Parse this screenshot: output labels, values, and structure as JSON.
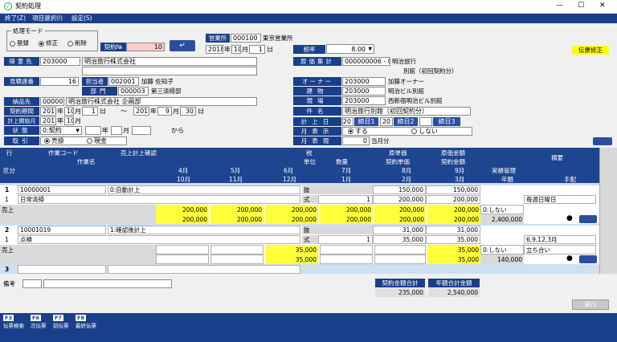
{
  "titlebar": {
    "title": "契約処理",
    "min": "—",
    "max": "☐",
    "close": "✕"
  },
  "menu": [
    "終了(Z)",
    "項目選択(I)",
    "設定(S)"
  ],
  "mode": {
    "legend": "処理モード",
    "options": [
      "登録",
      "修正",
      "削除"
    ],
    "selected": 1
  },
  "contract_no": {
    "label": "契約№",
    "value": "10"
  },
  "office": {
    "label": "営業所",
    "code": "000100",
    "name": "東京営業所"
  },
  "date": {
    "year": "2018",
    "month": "10",
    "day": "1",
    "y": "年",
    "m": "月",
    "d": "日"
  },
  "tax": {
    "label": "税率",
    "value": "8.00"
  },
  "badge": "伝票修正",
  "client": {
    "label": "得意先",
    "code": "203000",
    "name": "明治旅行株式会社"
  },
  "cost_total": {
    "label": "原価集計",
    "code": "000000006 - 01",
    "name1": "明治旅行",
    "name2": "別館（初回契約分）"
  },
  "estimate": {
    "label": "見積連番",
    "value": "16"
  },
  "person": {
    "label": "担当者",
    "code": "002001",
    "name": "加藤 佐知子"
  },
  "dept": {
    "label": "部門",
    "code": "000003",
    "name": "第三清掃部"
  },
  "owner": {
    "label": "オーナー",
    "code": "203000",
    "name": "加藤オーナー"
  },
  "building": {
    "label": "建物",
    "code": "203000",
    "name": "明治ビル別館"
  },
  "site": {
    "label": "現場",
    "code": "203000",
    "name": "西新宿明治ビル別館"
  },
  "delivery": {
    "label": "納品先",
    "code": "000001",
    "name": "明治旅行株式会社 企画部"
  },
  "subject": {
    "label": "件名",
    "value": "明治旅行別館（初回契約分）"
  },
  "period": {
    "label": "契約期間",
    "from_y": "2018",
    "from_m": "10",
    "from_d": "1",
    "tilde": "〜",
    "to_y": "2019",
    "to_m": "9",
    "to_d": "30"
  },
  "bill_start": {
    "label": "計上開始月",
    "y": "2018",
    "m": "10"
  },
  "bill_date": {
    "label": "計上日",
    "v1": "20",
    "l1": "締日1",
    "v2": "20",
    "l2": "締日2",
    "v3": "",
    "l3": "締日3"
  },
  "status": {
    "label": "状態",
    "value": "0:契約",
    "y": "年",
    "m": "月",
    "from": "から"
  },
  "month_disp": {
    "label": "月表示",
    "options": [
      "する",
      "しない"
    ],
    "selected": 0
  },
  "trade": {
    "label": "取引",
    "options": [
      "売掛",
      "現金"
    ],
    "selected": 0
  },
  "month_expr": {
    "label": "月表現",
    "value": "0",
    "suffix": "当月分"
  },
  "grid": {
    "head1": {
      "row": "行",
      "code": "作業コード",
      "confirm": "売上計上確認",
      "tax": "税",
      "cost": "原単価",
      "cost_amt": "原価金額",
      "memo": "摘要"
    },
    "head2": {
      "name": "作業名",
      "unit": "単位",
      "qty": "数量",
      "price": "契約単価",
      "amount": "契約金額",
      "perf": "実績管理"
    },
    "head3": {
      "kbn": "区分",
      "m1": "4月",
      "m2": "5月",
      "m3": "6月",
      "m4": "7月",
      "m5": "8月",
      "m6": "9月"
    },
    "head4": {
      "m1": "10月",
      "m2": "11月",
      "m3": "12月",
      "m4": "1月",
      "m5": "2月",
      "m6": "3月",
      "year": "年額",
      "arr": "手配"
    },
    "rows": [
      {
        "no": "1",
        "code": "10000001",
        "confirm": "0:自動計上",
        "tax": "抜",
        "cost": "150,000",
        "cost_amt": "150,000",
        "sub": "1",
        "name": "日常清掃",
        "unit": "式",
        "qty": "1",
        "price": "200,000",
        "amount": "200,000",
        "memo": "毎週日曜日",
        "kbn": "売上",
        "r1": [
          "200,000",
          "200,000",
          "200,000",
          "200,000",
          "200,000",
          "200,000"
        ],
        "perf": "0:しない",
        "r2": [
          "200,000",
          "200,000",
          "200,000",
          "200,000",
          "200,000",
          "200,000"
        ],
        "year": "2,400,000"
      },
      {
        "no": "2",
        "code": "10001019",
        "confirm": "1:確認後計上",
        "tax": "抜",
        "cost": "31,000",
        "cost_amt": "31,000",
        "sub": "1",
        "name": "点検",
        "unit": "式",
        "qty": "1",
        "price": "35,000",
        "amount": "35,000",
        "memo": "6,9,12,3月",
        "memo2": "立ち合い",
        "kbn": "売上",
        "r1": [
          "",
          "",
          "35,000",
          "",
          "",
          "35,000"
        ],
        "perf": "0:しない",
        "r2": [
          "",
          "",
          "35,000",
          "",
          "",
          "35,000"
        ],
        "year": "140,000"
      }
    ],
    "row3": "3"
  },
  "remarks": {
    "label": "備考"
  },
  "totals": {
    "contract_label": "契約金額合計",
    "contract_value": "235,000",
    "year_label": "年額合計金額",
    "year_value": "2,540,000"
  },
  "exec": "実行",
  "fkeys": [
    {
      "k": "F3",
      "t": "伝票検索"
    },
    {
      "k": "F6",
      "t": "次伝票"
    },
    {
      "k": "F7",
      "t": "前伝票"
    },
    {
      "k": "F8",
      "t": "最終伝票"
    }
  ],
  "colors": {
    "nav": "#1a3f8a",
    "yellow": "#ffff3a",
    "pink": "#ffcccc",
    "badge": "#ffff00"
  }
}
